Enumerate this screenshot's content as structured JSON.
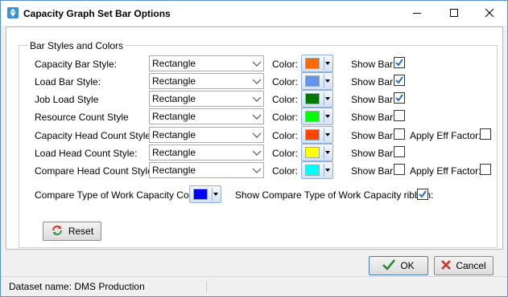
{
  "window": {
    "title": "Capacity Graph Set Bar Options"
  },
  "group": {
    "legend": "Bar Styles and Colors"
  },
  "labels": {
    "color": "Color:",
    "show_bar": "Show Bar:",
    "apply_eff_factor": "Apply Eff Factor:"
  },
  "rows": [
    {
      "label": "Capacity Bar Style:",
      "style": "Rectangle",
      "color": "#ff6a00",
      "show_bar": true,
      "has_eff": false
    },
    {
      "label": "Load Bar Style:",
      "style": "Rectangle",
      "color": "#6495ed",
      "show_bar": true,
      "has_eff": false
    },
    {
      "label": "Job Load Style",
      "style": "Rectangle",
      "color": "#007a00",
      "show_bar": true,
      "has_eff": false
    },
    {
      "label": "Resource Count Style",
      "style": "Rectangle",
      "color": "#00ff00",
      "show_bar": false,
      "has_eff": false
    },
    {
      "label": "Capacity Head Count Style:",
      "style": "Rectangle",
      "color": "#ff4500",
      "show_bar": false,
      "has_eff": true,
      "apply_eff": false
    },
    {
      "label": "Load Head Count Style:",
      "style": "Rectangle",
      "color": "#ffff00",
      "show_bar": false,
      "has_eff": false
    },
    {
      "label": "Compare Head Count Style:",
      "style": "Rectangle",
      "color": "#00ffff",
      "show_bar": false,
      "has_eff": true,
      "apply_eff": false
    }
  ],
  "compare": {
    "type_color_label": "Compare Type of Work Capacity Color:",
    "type_color": "#0000ff",
    "ribbon_label": "Show Compare Type of Work Capacity ribbon:",
    "ribbon_checked": true
  },
  "buttons": {
    "reset": "Reset",
    "ok": "OK",
    "cancel": "Cancel"
  },
  "status": {
    "dataset": "Dataset name:  DMS Production"
  }
}
